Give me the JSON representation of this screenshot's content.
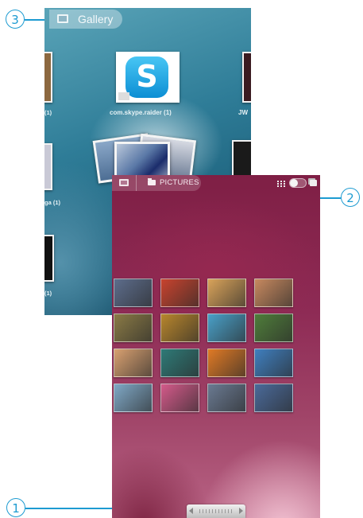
{
  "callouts": [
    "1",
    "2",
    "3"
  ],
  "gallery_screen": {
    "title": "Gallery",
    "app_icon": "gallery-app-icon",
    "albums": [
      {
        "label": "com.skype.raider  (1)",
        "icon": "skype-icon",
        "icon_text": "S"
      },
      {
        "label": "(1)"
      },
      {
        "label": "ga  (1)"
      },
      {
        "label": "(1)"
      },
      {
        "label": "JW"
      }
    ]
  },
  "pictures_screen": {
    "breadcrumb_root_icon": "gallery-icon",
    "folder_icon": "folder-icon",
    "title": "PICTURES",
    "view_toggle": "grid-stack-view-switch",
    "thumbnail_colors": [
      [
        "#5d6d8c",
        "#c8432e",
        "#d9a35a",
        "#c7895f"
      ],
      [
        "#8a7a45",
        "#b8862c",
        "#49a0c8",
        "#4f7d3a"
      ],
      [
        "#d8a070",
        "#2e7a77",
        "#e07a25",
        "#3f7fbf"
      ],
      [
        "#7fa8c6",
        "#d45a8a",
        "#6a7a92",
        "#4a6a9a"
      ]
    ],
    "scrollbar": "horizontal-scroll-handle"
  },
  "accent_color": "#1d9bd1"
}
